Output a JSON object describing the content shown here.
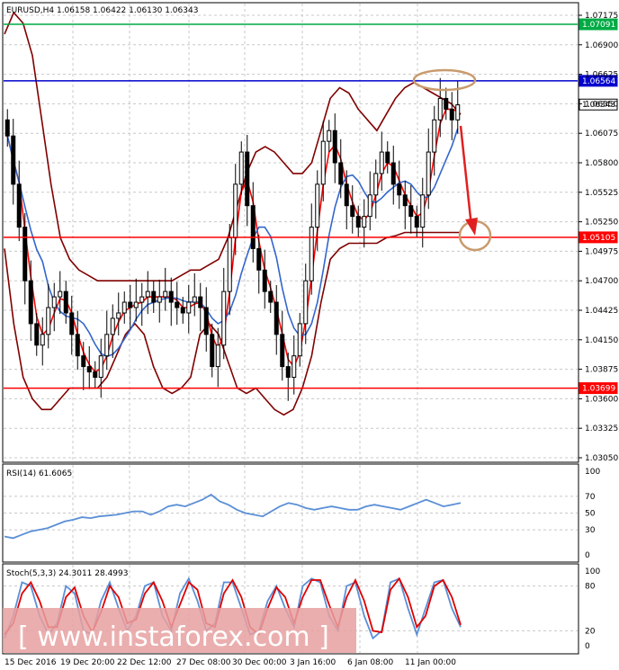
{
  "main_header": {
    "text": "EURUSD,H4  1.06158 1.06422 1.06130 1.06343"
  },
  "rsi_header": {
    "text": "RSI(14) 61.6065"
  },
  "stoch_header": {
    "text": "Stoch(5,3,3) 24.3011 28.4993"
  },
  "watermark": {
    "text": "[ www.instaforex.com ]"
  },
  "colors": {
    "candle": "#000000",
    "bollinger": "#800000",
    "ma_fast": "#ff0000",
    "ma_slow": "#3366cc",
    "resistance_green": "#00aa44",
    "resistance_blue": "#0000cc",
    "support_red": "#ff0000",
    "rsi": "#5b8fd6",
    "stoch_main": "#5b8fd6",
    "stoch_signal": "#e00000",
    "annotation_circle": "#c89b6d",
    "annotation_arrow": "#e02020",
    "watermark_bg": "#e8a0a0"
  },
  "chart_data": [
    {
      "type": "candlestick",
      "title": "EURUSD,H4",
      "ohlc_current": {
        "open": 1.06158,
        "high": 1.06422,
        "low": 1.0613,
        "close": 1.06343
      },
      "y_ticks": [
        "1.07175",
        "1.06900",
        "1.06625",
        "1.06350",
        "1.06075",
        "1.05800",
        "1.05525",
        "1.05250",
        "1.04975",
        "1.04700",
        "1.04425",
        "1.04150",
        "1.03875",
        "1.03600",
        "1.03325",
        "1.03050"
      ],
      "ylim": [
        1.0305,
        1.07175
      ],
      "x_ticks": [
        "15 Dec 2016",
        "19 Dec 20:00",
        "22 Dec 12:00",
        "27 Dec 08:00",
        "30 Dec 00:00",
        "3 Jan 16:00",
        "6 Jan 08:00",
        "11 Jan 00:00"
      ],
      "levels": [
        {
          "value": 1.07091,
          "label": "1.07091",
          "color": "#00aa44"
        },
        {
          "value": 1.06564,
          "label": "1.06564",
          "color": "#0000cc"
        },
        {
          "value": 1.06343,
          "label": "1.06343",
          "color": "#000000"
        },
        {
          "value": 1.05105,
          "label": "1.05105",
          "color": "#ff0000"
        },
        {
          "value": 1.03699,
          "label": "1.03699",
          "color": "#ff0000"
        }
      ],
      "closes": [
        1.0605,
        1.056,
        1.052,
        1.047,
        1.043,
        1.041,
        1.042,
        1.0445,
        1.0455,
        1.046,
        1.044,
        1.042,
        1.04,
        1.039,
        1.0385,
        1.038,
        1.04,
        1.042,
        1.0435,
        1.044,
        1.045,
        1.0445,
        1.045,
        1.0455,
        1.046,
        1.045,
        1.0455,
        1.046,
        1.045,
        1.0445,
        1.044,
        1.045,
        1.0455,
        1.0445,
        1.042,
        1.039,
        1.041,
        1.046,
        1.051,
        1.056,
        1.059,
        1.054,
        1.05,
        1.048,
        1.046,
        1.045,
        1.042,
        1.039,
        1.038,
        1.04,
        1.043,
        1.047,
        1.052,
        1.056,
        1.06,
        1.061,
        1.058,
        1.056,
        1.054,
        1.053,
        1.052,
        1.053,
        1.055,
        1.057,
        1.059,
        1.058,
        1.056,
        1.055,
        1.054,
        1.053,
        1.052,
        1.055,
        1.059,
        1.062,
        1.064,
        1.063,
        1.062,
        1.0634
      ],
      "bb_upper": [
        1.07,
        1.072,
        1.071,
        1.068,
        1.062,
        1.056,
        1.051,
        1.049,
        1.048,
        1.0475,
        1.047,
        1.047,
        1.047,
        1.047,
        1.047,
        1.047,
        1.047,
        1.047,
        1.047,
        1.0475,
        1.048,
        1.048,
        1.0485,
        1.049,
        1.051,
        1.054,
        1.057,
        1.059,
        1.0595,
        1.059,
        1.058,
        1.057,
        1.057,
        1.058,
        1.061,
        1.064,
        1.065,
        1.0645,
        1.063,
        1.062,
        1.061,
        1.0625,
        1.064,
        1.065,
        1.0655,
        1.065,
        1.0645,
        1.064,
        1.0635,
        1.0625
      ],
      "bb_lower": [
        1.05,
        1.043,
        1.038,
        1.036,
        1.035,
        1.035,
        1.036,
        1.037,
        1.037,
        1.037,
        1.037,
        1.038,
        1.04,
        1.042,
        1.043,
        1.042,
        1.039,
        1.037,
        1.0365,
        1.037,
        1.038,
        1.042,
        1.043,
        1.042,
        1.0395,
        1.037,
        1.0365,
        1.037,
        1.036,
        1.035,
        1.0345,
        1.035,
        1.037,
        1.04,
        1.045,
        1.049,
        1.05,
        1.0505,
        1.0505,
        1.0505,
        1.0505,
        1.051,
        1.0512,
        1.0515,
        1.0515,
        1.0515,
        1.0515,
        1.0515,
        1.0515,
        1.0515
      ]
    },
    {
      "type": "line",
      "title": "RSI(14)",
      "value": 61.6065,
      "ylim": [
        0,
        100
      ],
      "y_ticks": [
        "100",
        "70",
        "50",
        "30",
        "0"
      ],
      "values": [
        22,
        20,
        24,
        28,
        30,
        32,
        36,
        40,
        42,
        45,
        44,
        46,
        47,
        48,
        50,
        52,
        52,
        48,
        52,
        58,
        60,
        58,
        62,
        66,
        72,
        64,
        60,
        54,
        50,
        48,
        46,
        52,
        58,
        62,
        60,
        56,
        54,
        56,
        58,
        56,
        54,
        54,
        58,
        60,
        58,
        56,
        54,
        58,
        62,
        66,
        62,
        58,
        60,
        62
      ]
    },
    {
      "type": "line",
      "title": "Stoch(5,3,3)",
      "main": 24.3011,
      "signal": 28.4993,
      "ylim": [
        0,
        100
      ],
      "y_ticks": [
        "100",
        "80",
        "20",
        "0"
      ],
      "main_values": [
        10,
        40,
        85,
        80,
        40,
        15,
        30,
        80,
        70,
        20,
        15,
        60,
        85,
        50,
        20,
        40,
        80,
        85,
        40,
        20,
        70,
        90,
        60,
        20,
        30,
        85,
        85,
        50,
        15,
        20,
        60,
        80,
        50,
        25,
        80,
        90,
        85,
        40,
        20,
        80,
        85,
        40,
        10,
        20,
        85,
        90,
        50,
        15,
        50,
        85,
        88,
        50,
        25
      ],
      "signal_values": [
        15,
        30,
        70,
        85,
        60,
        25,
        25,
        65,
        78,
        40,
        18,
        45,
        80,
        65,
        30,
        35,
        70,
        85,
        60,
        25,
        55,
        85,
        75,
        30,
        25,
        70,
        88,
        65,
        25,
        15,
        50,
        78,
        65,
        30,
        65,
        88,
        88,
        55,
        25,
        65,
        88,
        60,
        20,
        18,
        75,
        90,
        65,
        25,
        40,
        80,
        88,
        65,
        28
      ]
    }
  ]
}
